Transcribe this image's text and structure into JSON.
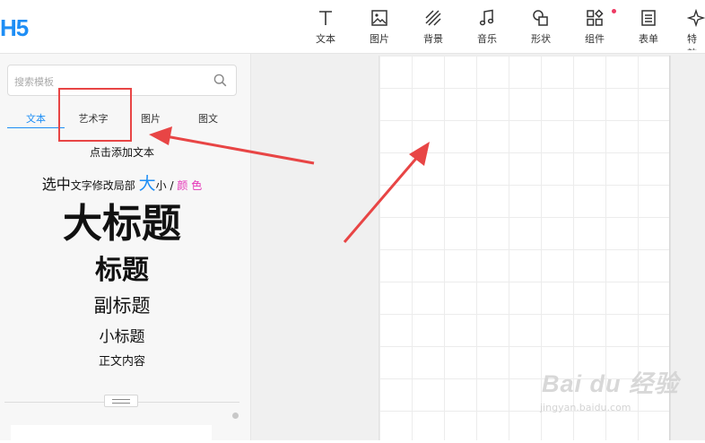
{
  "app": {
    "logo": "H5"
  },
  "toolbar": [
    {
      "label": "文本",
      "icon": "text-icon"
    },
    {
      "label": "图片",
      "icon": "image-icon"
    },
    {
      "label": "背景",
      "icon": "background-icon"
    },
    {
      "label": "音乐",
      "icon": "music-icon"
    },
    {
      "label": "形状",
      "icon": "shape-icon"
    },
    {
      "label": "组件",
      "icon": "components-icon",
      "badge": true
    },
    {
      "label": "表单",
      "icon": "form-icon"
    },
    {
      "label": "特效",
      "icon": "effects-icon"
    }
  ],
  "sidebar": {
    "search_placeholder": "搜索模板",
    "tabs": [
      {
        "label": "文本",
        "active": true
      },
      {
        "label": "艺术字",
        "active": false
      },
      {
        "label": "图片",
        "active": false
      },
      {
        "label": "图文",
        "active": false
      }
    ],
    "click_to_add": "点击添加文本",
    "style_hint": {
      "select": "选中",
      "middle": "文字修改局部",
      "big": "大",
      "small": "小",
      "slash": "/",
      "color": "颜 色"
    },
    "presets": {
      "big_title": "大标题",
      "title": "标题",
      "subtitle": "副标题",
      "small_title": "小标题",
      "body": "正文内容"
    }
  },
  "watermark": {
    "brand": "Bai du 经验",
    "url": "jingyan.baidu.com"
  },
  "colors": {
    "accent": "#1e8ef5",
    "annotation": "#e84545",
    "hint_color": "#e535b8",
    "badge": "#ee3a63"
  }
}
